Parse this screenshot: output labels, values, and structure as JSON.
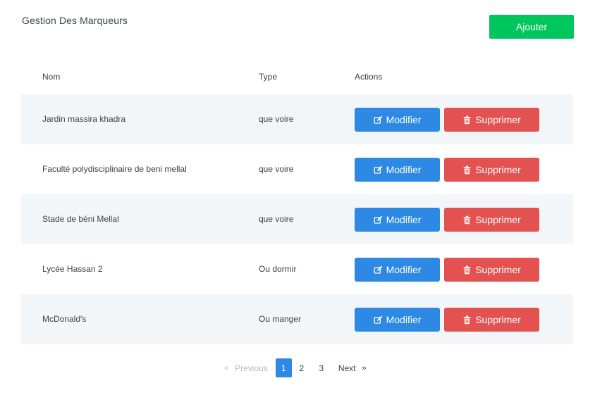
{
  "header": {
    "title": "Gestion Des Marqueurs",
    "add_label": "Ajouter"
  },
  "table": {
    "columns": [
      "Nom",
      "Type",
      "Actions"
    ],
    "rows": [
      {
        "nom": "Jardin massira khadra",
        "type": "que voire"
      },
      {
        "nom": "Faculté polydisciplinaire de beni mellal",
        "type": "que voire"
      },
      {
        "nom": "Stade de béni Mellal",
        "type": "que voire"
      },
      {
        "nom": "Lycée Hassan 2",
        "type": "Ou dormir"
      },
      {
        "nom": "McDonald's",
        "type": "Ou manger"
      }
    ],
    "edit_label": "Modifier",
    "delete_label": "Supprimer"
  },
  "pagination": {
    "prev_arrow": "«",
    "prev_label": "Previous",
    "pages": [
      "1",
      "2",
      "3"
    ],
    "current": "1",
    "next_label": "Next",
    "next_arrow": "»"
  },
  "colors": {
    "add": "#00c65e",
    "edit": "#2d89e3",
    "delete": "#e35151",
    "stripe": "#f2f6f8"
  },
  "icons": {
    "edit": "edit-icon",
    "delete": "trash-icon"
  }
}
